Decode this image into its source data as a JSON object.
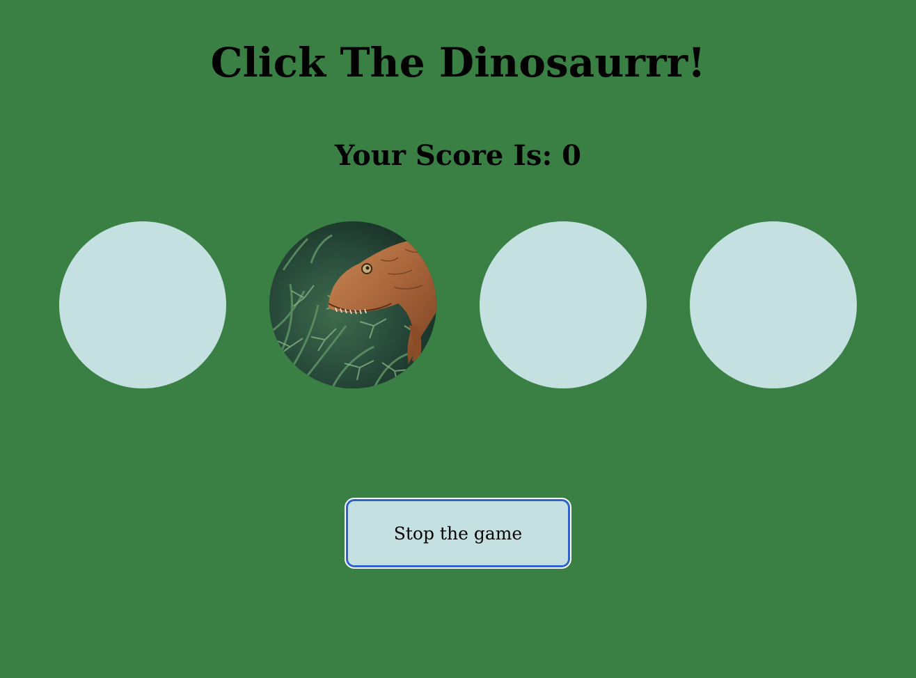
{
  "game": {
    "title": "Click The Dinosaurrr!",
    "score_label": "Your Score Is: ",
    "score_value": "0",
    "holes": [
      {
        "has_dinosaur": false
      },
      {
        "has_dinosaur": true
      },
      {
        "has_dinosaur": false
      },
      {
        "has_dinosaur": false
      }
    ],
    "stop_button_label": "Stop the game"
  },
  "colors": {
    "background": "#3a8044",
    "hole_fill": "#c4e0e0",
    "button_border": "#2f63c9",
    "text": "#000000"
  },
  "icons": {
    "dinosaur": "dinosaur-image"
  }
}
